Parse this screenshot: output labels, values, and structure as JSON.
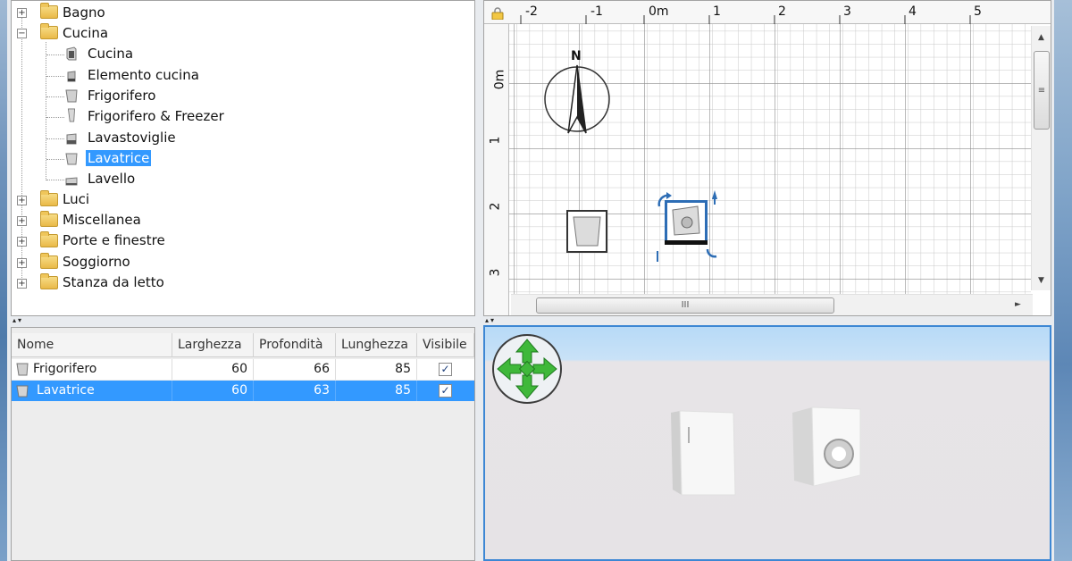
{
  "catalog": {
    "categories": [
      {
        "label": "Bagno",
        "expanded": false
      },
      {
        "label": "Cucina",
        "expanded": true
      },
      {
        "label": "Luci",
        "expanded": false
      },
      {
        "label": "Miscellanea",
        "expanded": false
      },
      {
        "label": "Porte e finestre",
        "expanded": false
      },
      {
        "label": "Soggiorno",
        "expanded": false
      },
      {
        "label": "Stanza da letto",
        "expanded": false
      }
    ],
    "cucina_items": [
      {
        "label": "Cucina",
        "icon": "kitchen-icon"
      },
      {
        "label": "Elemento cucina",
        "icon": "kitchen-cabinet-icon"
      },
      {
        "label": "Frigorifero",
        "icon": "fridge-icon"
      },
      {
        "label": "Frigorifero & Freezer",
        "icon": "fridge-freezer-icon"
      },
      {
        "label": "Lavastoviglie",
        "icon": "dishwasher-icon"
      },
      {
        "label": "Lavatrice",
        "icon": "washing-machine-icon",
        "selected": true
      },
      {
        "label": "Lavello",
        "icon": "sink-icon"
      }
    ]
  },
  "furniture_table": {
    "columns": [
      "Nome",
      "Larghezza",
      "Profondità",
      "Lunghezza",
      "Visibile"
    ],
    "rows": [
      {
        "name": "Frigorifero",
        "width": "60",
        "depth": "66",
        "height": "85",
        "visible": true,
        "selected": false
      },
      {
        "name": "Lavatrice",
        "width": "60",
        "depth": "63",
        "height": "85",
        "visible": true,
        "selected": true
      }
    ]
  },
  "plan": {
    "top_ruler": [
      "-2",
      "-1",
      "0m",
      "1",
      "2",
      "3",
      "4",
      "5"
    ],
    "left_ruler": [
      "0m",
      "1",
      "2",
      "3"
    ],
    "compass_label": "N"
  },
  "colors": {
    "selection": "#3399ff",
    "view3d_border": "#3d87d4",
    "nav_green": "#3fb83a"
  }
}
